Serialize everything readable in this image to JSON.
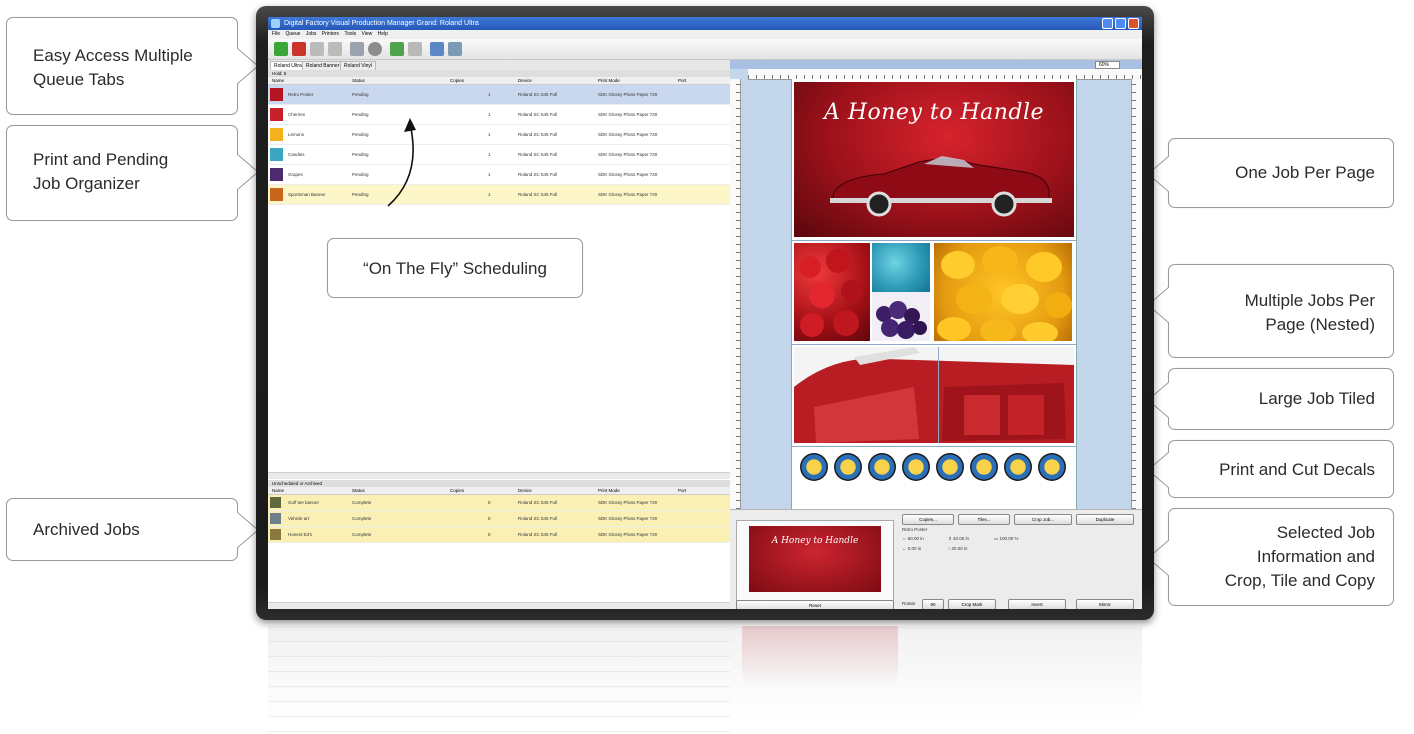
{
  "callouts": {
    "queue_tabs": [
      "Easy Access Multiple",
      "Queue Tabs"
    ],
    "organizer": [
      "Print and Pending",
      "Job Organizer"
    ],
    "on_the_fly": "“On The Fly” Scheduling",
    "archived": "Archived Jobs",
    "one_job": "One Job Per Page",
    "multiple": [
      "Multiple Jobs Per",
      "Page (Nested)"
    ],
    "large_tiled": "Large Job Tiled",
    "print_cut": "Print and Cut Decals",
    "selected": [
      "Selected Job",
      "Information and",
      "Crop, Tile and Copy"
    ]
  },
  "app": {
    "title": "Digital Factory Visual Production Manager Grand: Roland Ultra",
    "menu": [
      "File",
      "Queue",
      "Jobs",
      "Printers",
      "Tools",
      "View",
      "Help"
    ],
    "tabs": [
      "Roland Ultra",
      "Roland Banner",
      "Roland Vinyl"
    ],
    "group_header": "Hold: 6",
    "columns": [
      "Name",
      "Status",
      "Copies",
      "Device",
      "Print Mode",
      "Port"
    ],
    "pending_jobs": [
      {
        "name": "Retro Poster",
        "status": "Pending",
        "copies": "1",
        "device": "Roland SC 545 Full",
        "mode": "SDK Glossy Photo Paper 720",
        "color": "#b5131f"
      },
      {
        "name": "Cherries",
        "status": "Pending",
        "copies": "1",
        "device": "Roland SC 545 Full",
        "mode": "SDK Glossy Photo Paper 720",
        "color": "#c8202a"
      },
      {
        "name": "Lemons",
        "status": "Pending",
        "copies": "1",
        "device": "Roland SC 545 Full",
        "mode": "SDK Glossy Photo Paper 720",
        "color": "#f3b21d"
      },
      {
        "name": "Candies",
        "status": "Pending",
        "copies": "1",
        "device": "Roland SC 545 Full",
        "mode": "SDK Glossy Photo Paper 720",
        "color": "#3ba6c2"
      },
      {
        "name": "Grapes",
        "status": "Pending",
        "copies": "1",
        "device": "Roland SC 545 Full",
        "mode": "SDK Glossy Photo Paper 720",
        "color": "#4b2a6e"
      },
      {
        "name": "Sportsman Banner",
        "status": "Pending",
        "copies": "1",
        "device": "Roland SC 545 Full",
        "mode": "SDK Glossy Photo Paper 720",
        "color": "#c8661c"
      }
    ],
    "archive_header": "Unscheduled or Archived",
    "archived_jobs": [
      {
        "name": "Golf tee banner",
        "status": "Complete",
        "copies": "8",
        "device": "Roland SC 545 Full",
        "mode": "SDK Glossy Photo Paper 720",
        "color": "#5f6a3a"
      },
      {
        "name": "Vehicle art",
        "status": "Complete",
        "copies": "8",
        "device": "Roland SC 545 Full",
        "mode": "SDK Glossy Photo Paper 720",
        "color": "#6d7e8c"
      },
      {
        "name": "Honest Ed's",
        "status": "Complete",
        "copies": "8",
        "device": "Roland SC 545 Full",
        "mode": "SDK Glossy Photo Paper 720",
        "color": "#8a7a42"
      }
    ],
    "preview": {
      "zoom": "60%",
      "job1_title": "A Honey to Handle",
      "decal_count": 8
    },
    "selected": {
      "thumb_title": "A Honey to Handle",
      "buttons_top": [
        "Copies...",
        "Tiles...",
        "Crop Job...",
        "Duplicate"
      ],
      "name": "Retro Poster",
      "w": "60.00 in",
      "h": "40.00 in",
      "scale": "100.00 %",
      "x": "0.00 in",
      "y": "20.00 in",
      "reset": "Reset",
      "rotate_label": "Rotate",
      "rotate_value": "90",
      "buttons_bottom": [
        "Crop Mark",
        "Invert",
        "Mirror"
      ]
    }
  },
  "colors": {
    "accent_blue": "#2557b8",
    "callout_border": "#9a9a9a",
    "selected_row": "#c9d8ee",
    "archive_row": "#faf0b4"
  }
}
